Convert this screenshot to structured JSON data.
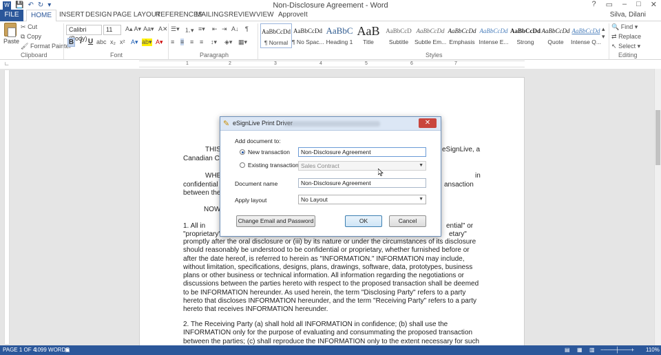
{
  "window": {
    "title": "Non-Disclosure Agreement - Word",
    "user": "Silva, Dilani",
    "controls": [
      "?",
      "▭",
      "–",
      "□",
      "✕"
    ]
  },
  "tabs": [
    "FILE",
    "HOME",
    "INSERT",
    "DESIGN",
    "PAGE LAYOUT",
    "REFERENCES",
    "MAILINGS",
    "REVIEW",
    "VIEW",
    "ApproveIt"
  ],
  "ribbon": {
    "clipboard": {
      "paste": "Paste",
      "cut": "Cut",
      "copy": "Copy",
      "format_painter": "Format Painter",
      "label": "Clipboard"
    },
    "font": {
      "name": "Calibri (Body)",
      "size": "11",
      "label": "Font",
      "bold": "B",
      "italic": "I",
      "underline": "U"
    },
    "paragraph": {
      "label": "Paragraph"
    },
    "styles": {
      "label": "Styles",
      "items": [
        {
          "sample": "AaBbCcDd",
          "name": "¶ Normal"
        },
        {
          "sample": "AaBbCcDd",
          "name": "¶ No Spac..."
        },
        {
          "sample": "AaBbC",
          "name": "Heading 1"
        },
        {
          "sample": "AaB",
          "name": "Title"
        },
        {
          "sample": "AaBbCcD",
          "name": "Subtitle"
        },
        {
          "sample": "AaBbCcDd",
          "name": "Subtle Em..."
        },
        {
          "sample": "AaBbCcDd",
          "name": "Emphasis"
        },
        {
          "sample": "AaBbCcDd",
          "name": "Intense E..."
        },
        {
          "sample": "AaBbCcDd",
          "name": "Strong"
        },
        {
          "sample": "AaBbCcDd",
          "name": "Quote"
        },
        {
          "sample": "AaBbCcDd",
          "name": "Intense Q..."
        }
      ]
    },
    "editing": {
      "find": "Find",
      "replace": "Replace",
      "select": "Select",
      "label": "Editing"
    }
  },
  "ruler": {
    "numbers": [
      "1",
      "2",
      "3",
      "4",
      "5",
      "6",
      "7"
    ]
  },
  "document": {
    "line_this": "THIS",
    "line_esignlive": "eSignLive,  a",
    "line_canadian": "Canadian Co",
    "line_whe": "WHE",
    "line_in": "in",
    "line_confidential": "confidential a",
    "line_ansaction": "ansaction",
    "line_between": "between the",
    "line_now": "NOW",
    "line_1": "1.        All in",
    "line_ential": "ential\" or",
    "line_proprietary": "\"proprietary\"",
    "line_etary": "etary\"",
    "para1": "promptly after the oral disclosure or (iii) by its nature or under the circumstances of its disclosure should reasonably be understood to be confidential or proprietary, whether furnished before or after the date hereof, is referred to herein as \"INFORMATION.\" INFORMATION may include, without limitation, specifications, designs, plans, drawings, software, data, prototypes, business plans or other business or technical information. All information regarding the negotiations or discussions between the parties hereto with respect to the proposed transaction shall be deemed to be INFORMATION hereunder. As used herein, the term \"Disclosing Party\" refers to a party hereto that discloses INFORMATION hereunder, and the term \"Receiving Party\" refers to a party hereto that receives INFORMATION hereunder.",
    "para2": "2.        The Receiving Party (a) shall hold all INFORMATION in confidence; (b) shall use the INFORMATION only for the purpose of evaluating and consummating the proposed transaction between the parties; (c) shall reproduce the INFORMATION only to the extent necessary for such purpose; (d)"
  },
  "dialog": {
    "title": "eSignLive Print Driver",
    "add_label": "Add document to:",
    "new_transaction": "New transaction",
    "new_transaction_value": "Non-Disclosure Agreement",
    "existing_transaction": "Existing transaction",
    "existing_value": "Sales Contract",
    "document_name_label": "Document name",
    "document_name_value": "Non-Disclosure Agreement",
    "apply_layout_label": "Apply layout",
    "apply_layout_value": "No Layout",
    "change_email_btn": "Change Email and Password",
    "ok_btn": "OK",
    "cancel_btn": "Cancel"
  },
  "status": {
    "page": "PAGE 1 OF 4",
    "words": "1099 WORDS",
    "zoom": "110%"
  }
}
